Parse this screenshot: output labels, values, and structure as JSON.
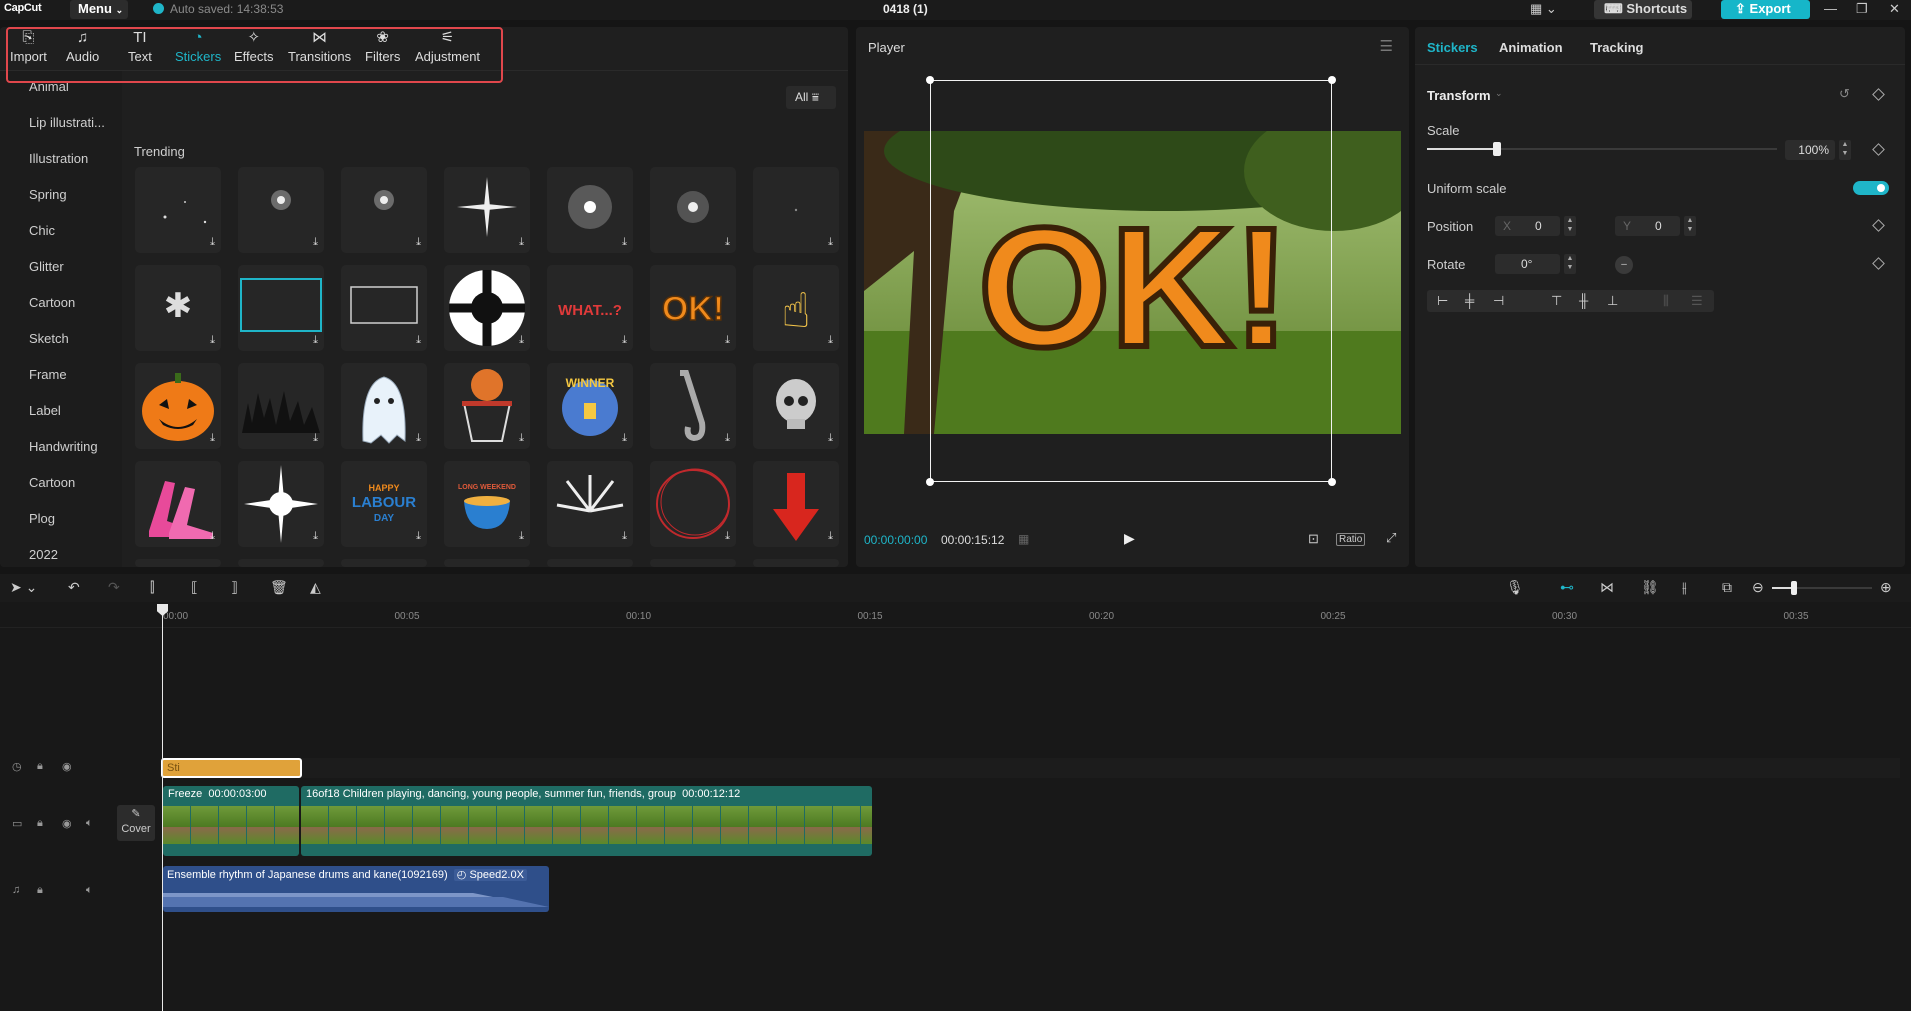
{
  "app": {
    "logo": "CapCut",
    "menu_label": "Menu",
    "autosave": "Auto saved: 14:38:53",
    "project_title": "0418 (1)",
    "shortcuts_label": "Shortcuts",
    "export_label": "Export"
  },
  "toolbar": {
    "items": [
      {
        "label": "Import",
        "icon": "import-icon"
      },
      {
        "label": "Audio",
        "icon": "audio-icon"
      },
      {
        "label": "Text",
        "icon": "text-icon"
      },
      {
        "label": "Stickers",
        "icon": "stickers-icon",
        "active": true
      },
      {
        "label": "Effects",
        "icon": "effects-icon"
      },
      {
        "label": "Transitions",
        "icon": "transitions-icon"
      },
      {
        "label": "Filters",
        "icon": "filters-icon"
      },
      {
        "label": "Adjustment",
        "icon": "adjustment-icon"
      }
    ]
  },
  "categories": [
    "Animal",
    "Lip illustrati...",
    "Illustration",
    "Spring",
    "Chic",
    "Glitter",
    "Cartoon",
    "Sketch",
    "Frame",
    "Label",
    "Handwriting",
    "Cartoon",
    "Plog",
    "2022"
  ],
  "filter": {
    "label": "All"
  },
  "stickers": {
    "section": "Trending",
    "tiles": [
      "sparkles-sticker",
      "starburst-sticker",
      "starburst-sticker",
      "star-flare-sticker",
      "glow-flare-sticker",
      "glow-sticker",
      "dot-sticker",
      "snowflake-sticker",
      "frame-sticker",
      "frame-sticker",
      "ball-sticker",
      "what-text-sticker",
      "ok-text-sticker",
      "pointing-hand-sticker",
      "pumpkin-sticker",
      "zombie-hands-sticker",
      "ghost-sticker",
      "basketball-sticker",
      "winner-sticker",
      "saxophone-sticker",
      "skull-sticker",
      "heels-sticker",
      "sparkle-sticker",
      "labour-day-sticker",
      "long-weekend-sticker",
      "burst-lines-sticker",
      "red-circle-sticker",
      "red-arrow-sticker"
    ],
    "sticker_text": {
      "what": "WHAT...?",
      "ok": "OK!",
      "winner": "WINNER",
      "labour_1": "HAPPY",
      "labour_2": "LABOUR",
      "labour_3": "DAY",
      "weekend": "LONG WEEKEND"
    }
  },
  "player": {
    "title": "Player",
    "overlay_text": "OK!",
    "current_time": "00:00:00:00",
    "total_time": "00:00:15:12",
    "ratio_label": "Ratio"
  },
  "inspector": {
    "tabs": [
      "Stickers",
      "Animation",
      "Tracking"
    ],
    "section": "Transform",
    "scale_label": "Scale",
    "scale_value": "100%",
    "scale_level": 0.2,
    "uniform_scale_label": "Uniform scale",
    "uniform_scale_on": true,
    "position_label": "Position",
    "pos_x_label": "X",
    "pos_x": "0",
    "pos_y_label": "Y",
    "pos_y": "0",
    "rotate_label": "Rotate",
    "rotate_value": "0°"
  },
  "timeline": {
    "ticks": [
      "00:00",
      "00:05",
      "00:10",
      "00:15",
      "00:20",
      "00:25",
      "00:30",
      "00:35"
    ],
    "cover_label": "Cover",
    "sticker_clip_label": "Sti",
    "freeze_clip": {
      "label": "Freeze",
      "duration": "00:00:03:00"
    },
    "video_clip": {
      "label": "16of18 Children playing, dancing, young people, summer fun, friends, group",
      "duration": "00:00:12:12"
    },
    "audio_clip": {
      "label": "Ensemble rhythm of Japanese drums and kane(1092169)",
      "speed": "Speed2.0X"
    }
  },
  "colors": {
    "accent": "#1fb5c8",
    "highlight": "#e0474c",
    "video_clip": "#1f6b63",
    "audio_clip": "#2f4f8a",
    "sticker_clip": "#e0a23a"
  }
}
